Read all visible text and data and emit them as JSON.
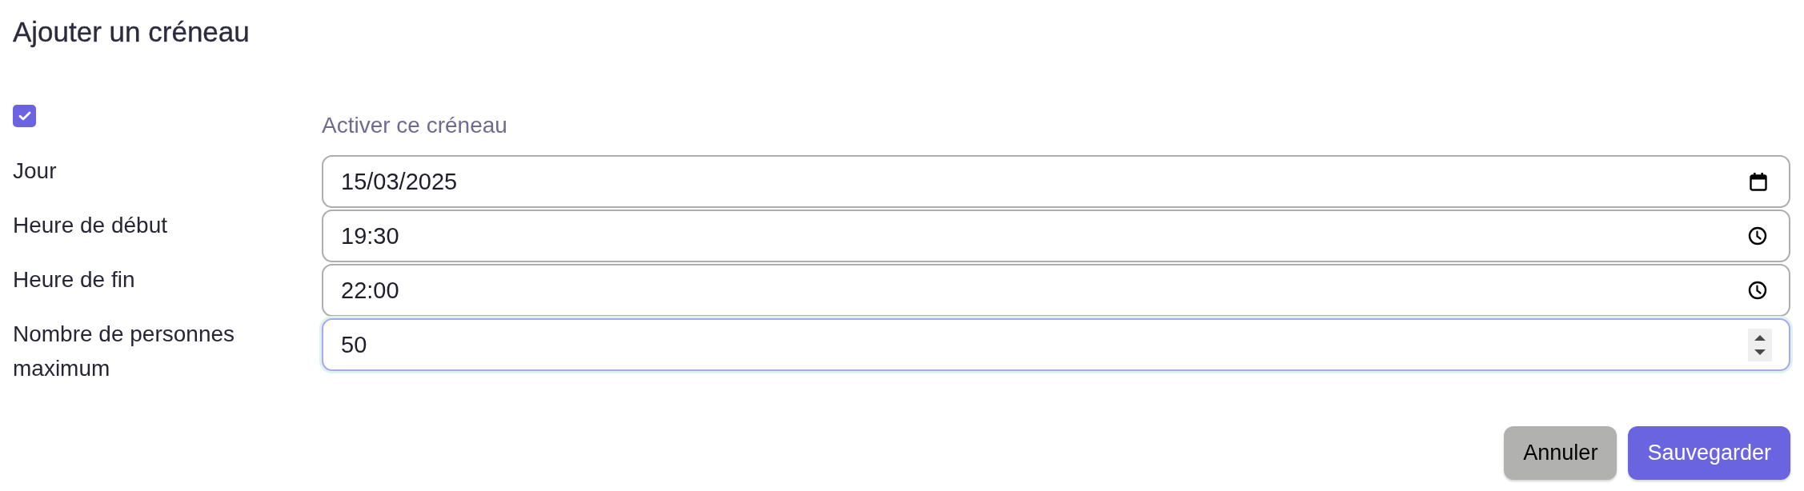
{
  "dialog": {
    "title": "Ajouter un créneau"
  },
  "enable": {
    "label": "Activer ce créneau",
    "checked": true
  },
  "fields": [
    {
      "kind": "date",
      "label": "Jour",
      "value": "15/03/2025",
      "focused": false
    },
    {
      "kind": "time",
      "label": "Heure de début",
      "value": "19:30",
      "focused": false
    },
    {
      "kind": "time",
      "label": "Heure de fin",
      "value": "22:00",
      "focused": false
    },
    {
      "kind": "number",
      "label": "Nombre de personnes maximum",
      "value": "50",
      "focused": true
    }
  ],
  "buttons": [
    {
      "kind": "secondary",
      "label": "Annuler"
    },
    {
      "kind": "primary",
      "label": "Sauvegarder"
    }
  ]
}
